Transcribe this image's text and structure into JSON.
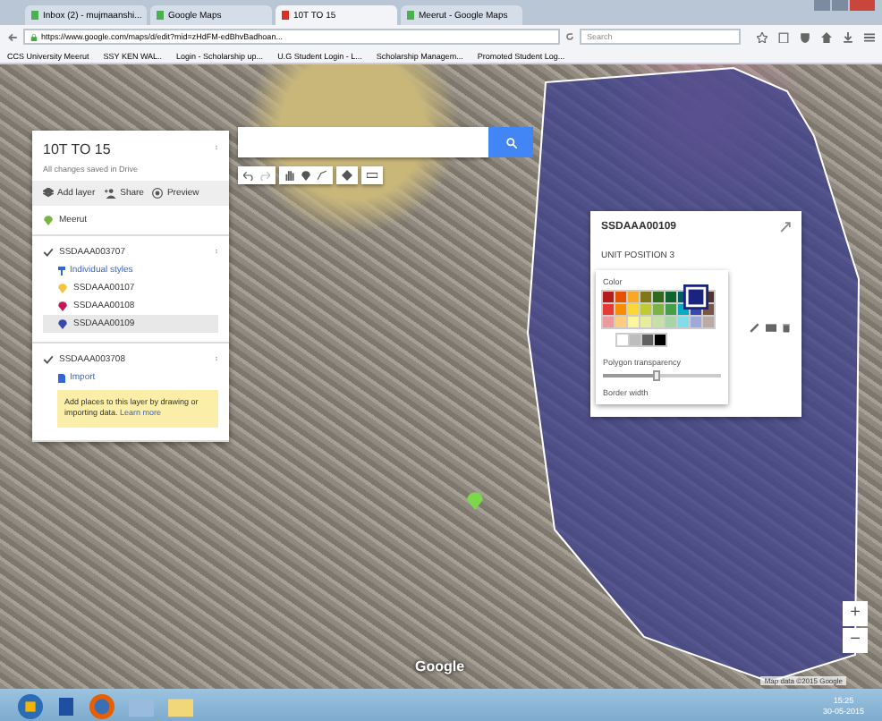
{
  "browser": {
    "tabs": [
      {
        "label": "Inbox (2) - mujmaanshi...",
        "selected": false
      },
      {
        "label": "Google Maps",
        "selected": false
      },
      {
        "label": "10T TO 15",
        "selected": true
      },
      {
        "label": "Meerut - Google Maps",
        "selected": false
      }
    ],
    "url": "https://www.google.com/maps/d/edit?mid=zHdFM-edBhvBadhoan...",
    "search": {
      "placeholder": "Search"
    },
    "bookmarks": [
      "CCS University Meerut",
      "SSY KEN WAL..",
      "Login - Scholarship up...",
      "U.G Student Login - L...",
      "Scholarship Managem...",
      "Promoted Student Log..."
    ]
  },
  "map_panel": {
    "title": "10T TO 15",
    "status": "All changes saved in Drive",
    "actions": [
      {
        "label": "Add layer",
        "kind": "add-layer"
      },
      {
        "label": "Share",
        "kind": "share"
      },
      {
        "label": "Preview",
        "kind": "preview"
      }
    ],
    "base": {
      "label": "Meerut"
    },
    "layers": [
      {
        "name": "SSDAAA003707",
        "checked": true,
        "style_link": "Individual styles",
        "items": [
          {
            "label": "SSDAAA00107",
            "color": "#f4c542",
            "selected": false
          },
          {
            "label": "SSDAAA00108",
            "color": "#c2185b",
            "selected": false
          },
          {
            "label": "SSDAAA00109",
            "color": "#3949ab",
            "selected": true
          }
        ]
      },
      {
        "name": "SSDAAA003708",
        "checked": true,
        "import_link": "Import",
        "note": "Add places to this layer by drawing or importing data.",
        "note_link": "Learn more"
      }
    ]
  },
  "feature_popup": {
    "title": "SSDAAA00109",
    "description": "UNIT POSITION 3"
  },
  "color_picker": {
    "label": "Color",
    "swatches": [
      {
        "color": "#b71c1c",
        "selected": false
      },
      {
        "color": "#e65100",
        "selected": false
      },
      {
        "color": "#f9a825",
        "selected": false
      },
      {
        "color": "#827717",
        "selected": false
      },
      {
        "color": "#33691e",
        "selected": false
      },
      {
        "color": "#0d652d",
        "selected": false
      },
      {
        "color": "#006064",
        "selected": false
      },
      {
        "color": "#1a237e",
        "selected": true
      },
      {
        "color": "#4e342e",
        "selected": false
      },
      {
        "color": "#e53935",
        "selected": false
      },
      {
        "color": "#fb8c00",
        "selected": false
      },
      {
        "color": "#fdd835",
        "selected": false
      },
      {
        "color": "#c0ca33",
        "selected": false
      },
      {
        "color": "#7cb342",
        "selected": false
      },
      {
        "color": "#43a047",
        "selected": false
      },
      {
        "color": "#00acc1",
        "selected": false
      },
      {
        "color": "#3949ab",
        "selected": false
      },
      {
        "color": "#795548",
        "selected": false
      },
      {
        "color": "#ef9a9a",
        "selected": false
      },
      {
        "color": "#ffcc80",
        "selected": false
      },
      {
        "color": "#fff59d",
        "selected": false
      },
      {
        "color": "#e6ee9c",
        "selected": false
      },
      {
        "color": "#c5e1a5",
        "selected": false
      },
      {
        "color": "#a5d6a7",
        "selected": false
      },
      {
        "color": "#80deea",
        "selected": false
      },
      {
        "color": "#9fa8da",
        "selected": false
      },
      {
        "color": "#bcaaa4",
        "selected": false
      }
    ],
    "gray_swatches": [
      {
        "color": "#ffffff",
        "selected": false
      },
      {
        "color": "#bdbdbd",
        "selected": false
      },
      {
        "color": "#616161",
        "selected": false
      },
      {
        "color": "#000000",
        "selected": false
      }
    ],
    "transparency_label": "Polygon transparency",
    "transparency": {
      "level": 0.45
    },
    "border_label": "Border width"
  },
  "map": {
    "zoom_in": "+",
    "zoom_out": "−",
    "logo": "Google",
    "attribution": "Map data ©2015 Google"
  },
  "taskbar": {
    "time": "15:25",
    "date": "30-05-2015"
  }
}
